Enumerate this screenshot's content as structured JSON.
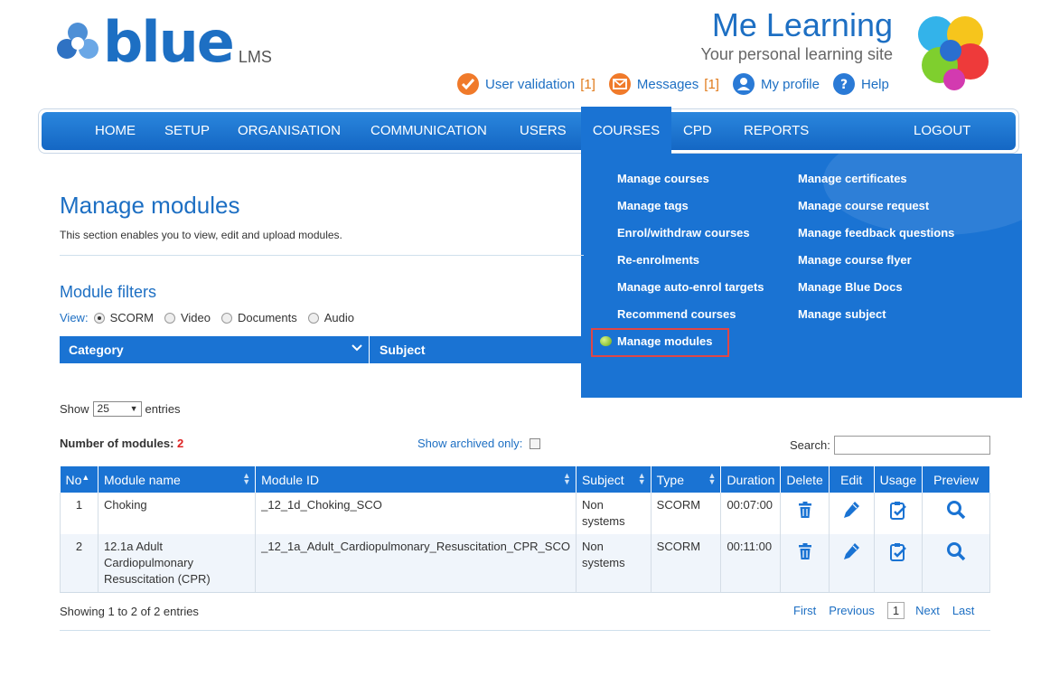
{
  "logo": {
    "word": "blue",
    "suffix": "LMS"
  },
  "site": {
    "title": "Me Learning",
    "tagline": "Your personal learning site"
  },
  "toplinks": [
    {
      "label": "User validation",
      "count": "[1]",
      "icon": "user-validation-icon"
    },
    {
      "label": "Messages",
      "count": "[1]",
      "icon": "messages-icon"
    },
    {
      "label": "My profile",
      "count": "",
      "icon": "profile-icon"
    },
    {
      "label": "Help",
      "count": "",
      "icon": "help-icon"
    }
  ],
  "nav": {
    "home": "HOME",
    "setup": "SETUP",
    "organisation": "ORGANISATION",
    "communication": "COMMUNICATION",
    "users": "USERS",
    "courses": "COURSES",
    "cpd": "CPD",
    "reports": "REPORTS",
    "logout": "LOGOUT"
  },
  "courses_menu": {
    "col1": [
      "Manage courses",
      "Manage tags",
      "Enrol/withdraw courses",
      "Re-enrolments",
      "Manage auto-enrol targets",
      "Recommend courses",
      "Manage modules"
    ],
    "col2": [
      "Manage certificates",
      "Manage course request",
      "Manage feedback questions",
      "Manage course flyer",
      "Manage Blue Docs",
      "Manage subject"
    ],
    "selected": "Manage modules"
  },
  "page": {
    "title": "Manage modules",
    "description": "This section enables you to view, edit and upload modules."
  },
  "filters": {
    "title": "Module filters",
    "view_label": "View",
    "view_options": [
      "SCORM",
      "Video",
      "Documents",
      "Audio"
    ],
    "selected_view": "SCORM",
    "category_label": "Category",
    "subject_label": "Subject"
  },
  "list": {
    "show_label": "Show",
    "entries_label": "entries",
    "page_size": "25",
    "count_label": "Number of modules:",
    "count": "2",
    "archived_label": "Show archived only:",
    "search_label": "Search:",
    "search_value": ""
  },
  "table": {
    "headers": [
      "No",
      "Module name",
      "Module ID",
      "Subject",
      "Type",
      "Duration",
      "Delete",
      "Edit",
      "Usage",
      "Preview"
    ],
    "rows": [
      {
        "no": "1",
        "name": "Choking",
        "id": "_12_1d_Choking_SCO",
        "subject": "Non systems",
        "type": "SCORM",
        "duration": "00:07:00"
      },
      {
        "no": "2",
        "name": "12.1a Adult Cardiopulmonary Resuscitation (CPR)",
        "id": "_12_1a_Adult_Cardiopulmonary_Resuscitation_CPR_SCO",
        "subject": "Non systems",
        "type": "SCORM",
        "duration": "00:11:00"
      }
    ]
  },
  "pagination": {
    "summary": "Showing 1 to 2 of 2 entries",
    "first": "First",
    "previous": "Previous",
    "current": "1",
    "next": "Next",
    "last": "Last"
  },
  "colors": {
    "brand_blue": "#1a73d3",
    "accent_orange": "#e07b1c",
    "count_red": "#dd2222",
    "highlight_red": "#e04646"
  }
}
